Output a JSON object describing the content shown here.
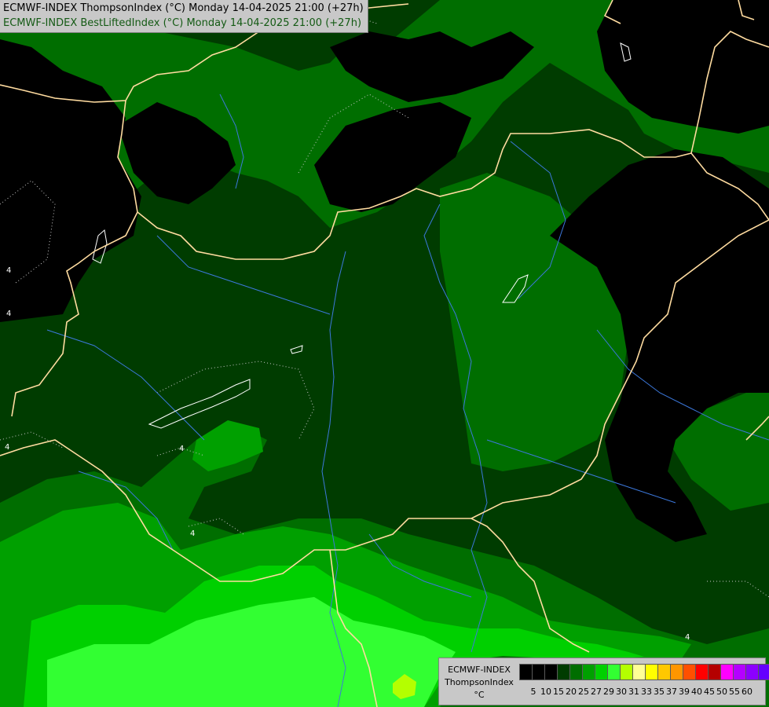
{
  "header": {
    "line1": "ECMWF-INDEX ThompsonIndex (°C) Monday 14-04-2025 21:00 (+27h)",
    "line2": "ECMWF-INDEX BestLiftedIndex (°C) Monday 14-04-2025 21:00 (+27h)",
    "line1_color": "#000000",
    "line2_color": "#145a14"
  },
  "legend": {
    "model": "ECMWF-INDEX",
    "parameter": "ThompsonIndex",
    "unit": "°C",
    "classes": [
      {
        "label": "5",
        "color": "#000000"
      },
      {
        "label": "10",
        "color": "#000000"
      },
      {
        "label": "15",
        "color": "#000000"
      },
      {
        "label": "20",
        "color": "#003c00"
      },
      {
        "label": "25",
        "color": "#006e00"
      },
      {
        "label": "27",
        "color": "#00a000"
      },
      {
        "label": "29",
        "color": "#00d000"
      },
      {
        "label": "30",
        "color": "#32ff32"
      },
      {
        "label": "31",
        "color": "#b4ff00"
      },
      {
        "label": "33",
        "color": "#ffff96"
      },
      {
        "label": "35",
        "color": "#ffff00"
      },
      {
        "label": "37",
        "color": "#ffc800"
      },
      {
        "label": "39",
        "color": "#ff9600"
      },
      {
        "label": "40",
        "color": "#ff5000"
      },
      {
        "label": "45",
        "color": "#ff0000"
      },
      {
        "label": "50",
        "color": "#b40000"
      },
      {
        "label": "55",
        "color": "#ff00ff"
      },
      {
        "label": "60",
        "color": "#b400ff"
      }
    ],
    "extra_swatches": [
      "#8c00ff",
      "#6400ff",
      "#0000ff"
    ]
  },
  "map": {
    "isoline_labels": [
      "4",
      "4",
      "4",
      "4",
      "4",
      "4"
    ],
    "colors": {
      "below_20": "#000000",
      "20_25": "#003c00",
      "25_27": "#006e00",
      "27_29": "#00a000",
      "29_30": "#00d000",
      "30_31": "#32ff32",
      "31_33": "#b4ff00",
      "border": "#ffdca0",
      "river": "#3c78dc",
      "isoline": "#c8c8c8"
    }
  }
}
